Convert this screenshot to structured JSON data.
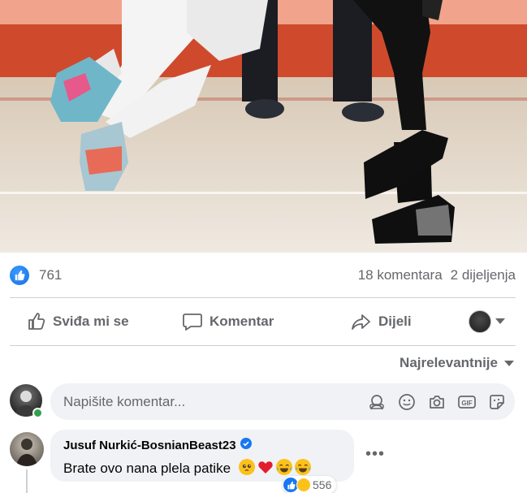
{
  "post": {
    "reactions": {
      "like_count": "761",
      "comments": "18 komentara",
      "shares": "2 dijeljenja"
    }
  },
  "actions": {
    "like": "Sviđa mi se",
    "comment": "Komentar",
    "share": "Dijeli"
  },
  "sort": {
    "label": "Najrelevantnije"
  },
  "composer": {
    "placeholder": "Napišite komentar..."
  },
  "comment": {
    "author": "Jusuf Nurkić-BosnianBeast23",
    "verified": true,
    "text": "Brate ovo nana plela patike",
    "emojis": [
      "pleading-face",
      "red-heart",
      "tears-of-joy",
      "tears-of-joy"
    ],
    "reaction_count": "556"
  },
  "colors": {
    "accent": "#1877f2",
    "muted": "#65676b",
    "bubble": "#f0f2f5",
    "online": "#31a24c"
  }
}
